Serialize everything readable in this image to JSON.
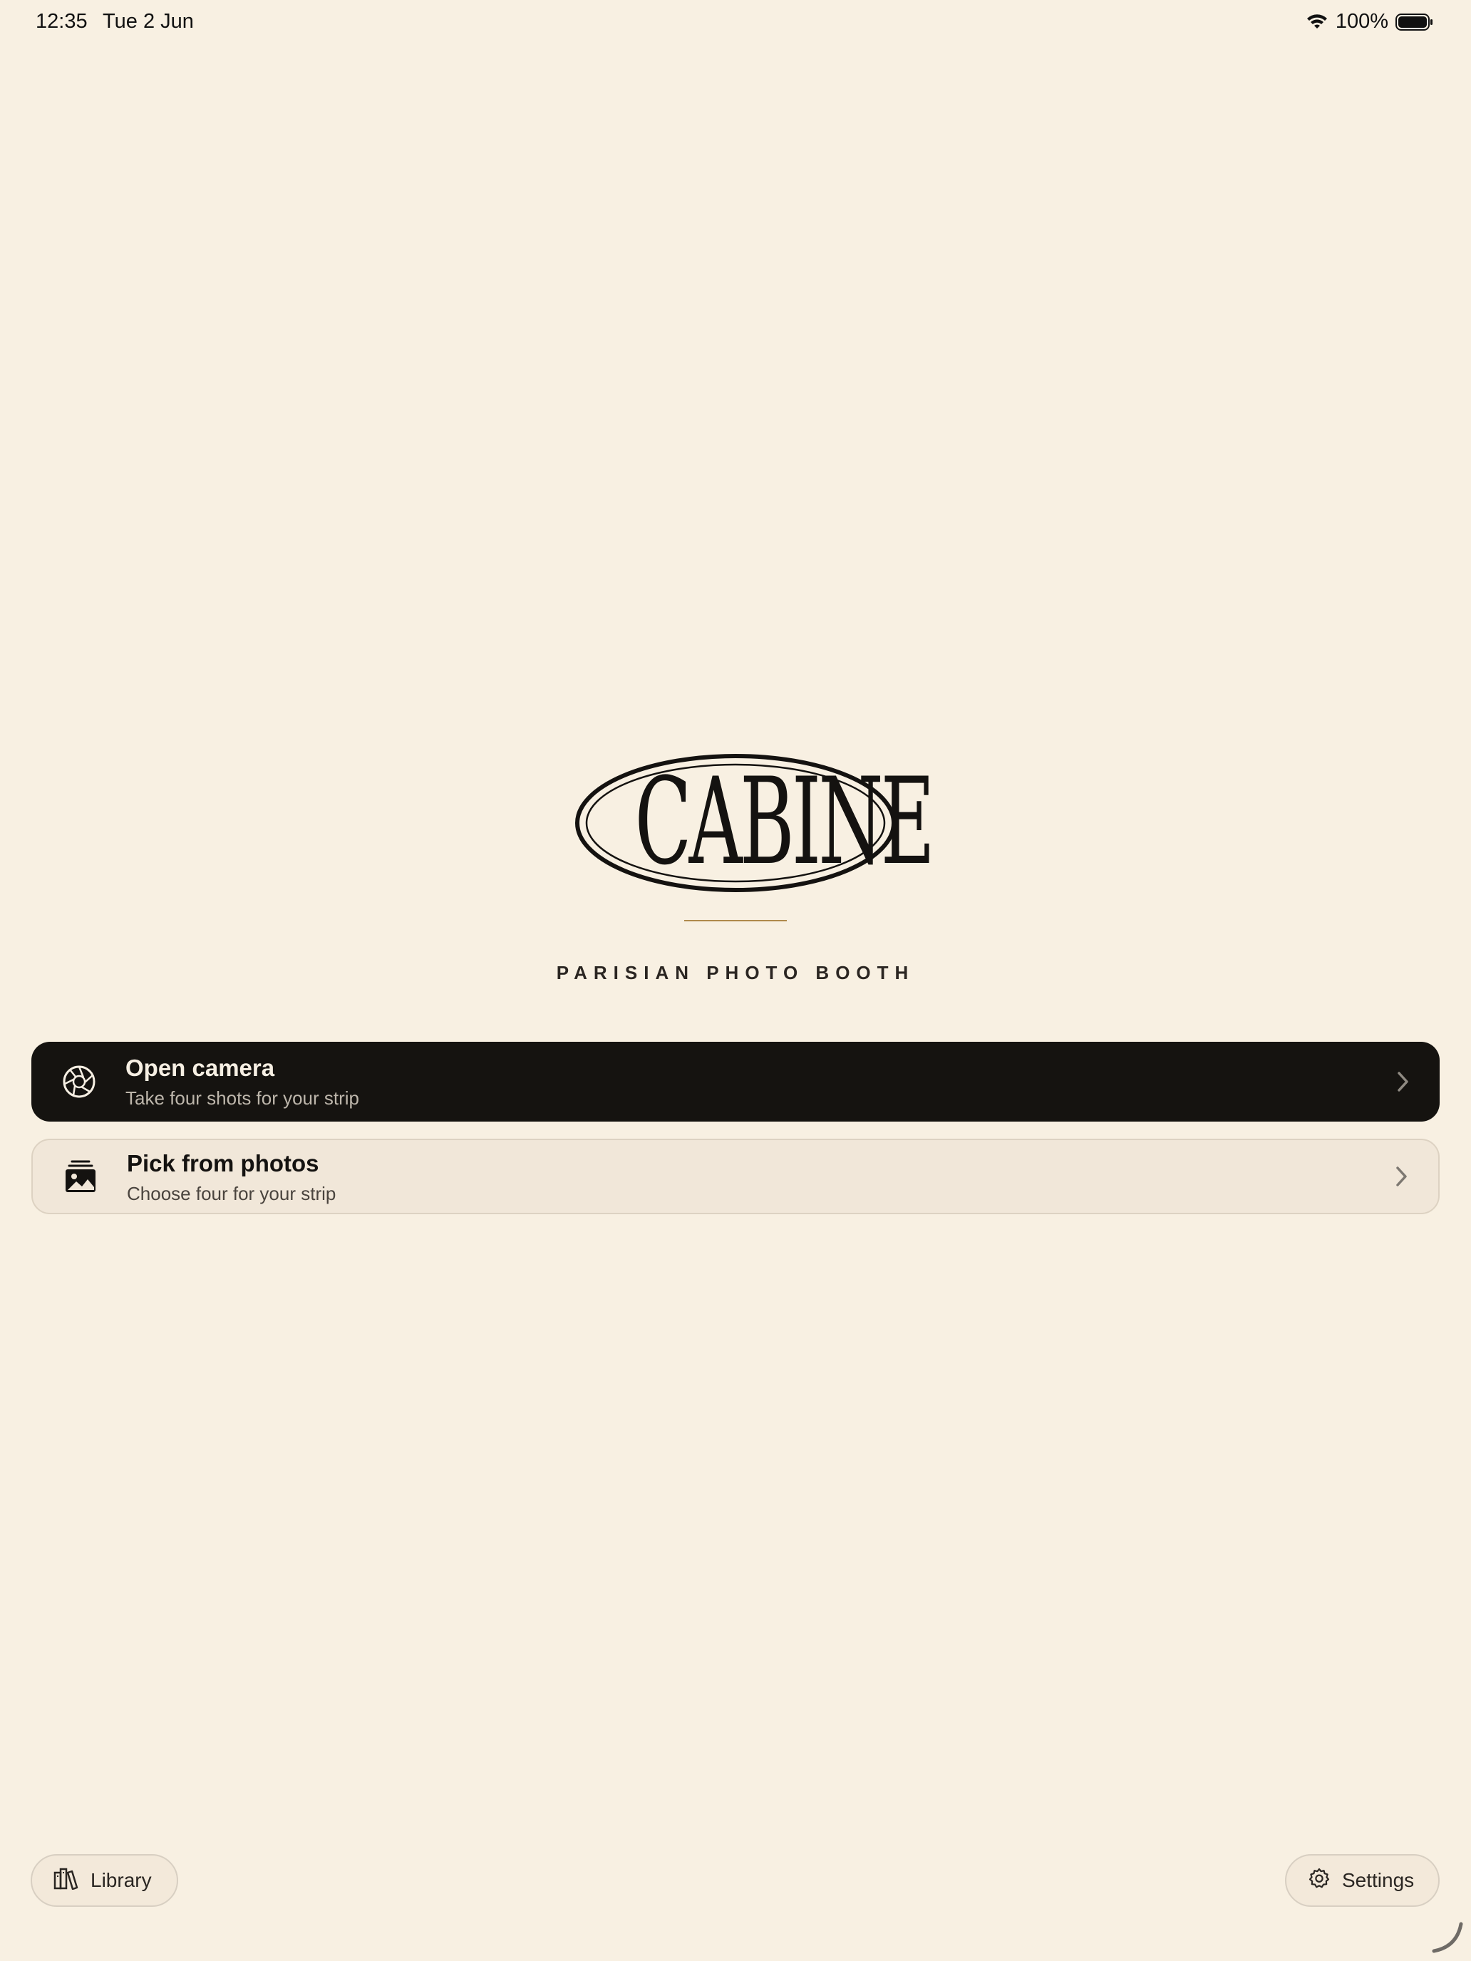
{
  "status_bar": {
    "time": "12:35",
    "date": "Tue 2 Jun",
    "battery": "100%",
    "wifi_icon": "wifi-icon",
    "battery_icon": "battery-icon"
  },
  "brand": {
    "logo_text": "CABINE",
    "tagline": "PARISIAN PHOTO BOOTH",
    "accent_color": "#b08a4c"
  },
  "actions": [
    {
      "title": "Open camera",
      "subtitle": "Take four shots for your strip",
      "icon": "aperture-icon"
    },
    {
      "title": "Pick from photos",
      "subtitle": "Choose four for your strip",
      "icon": "photo-stack-icon"
    }
  ],
  "footer": {
    "library_label": "Library",
    "library_icon": "books-icon",
    "settings_label": "Settings",
    "settings_icon": "gear-icon"
  },
  "colors": {
    "background": "#f8f0e2",
    "primary_card": "#151310",
    "secondary_card": "#f1e7d9"
  }
}
